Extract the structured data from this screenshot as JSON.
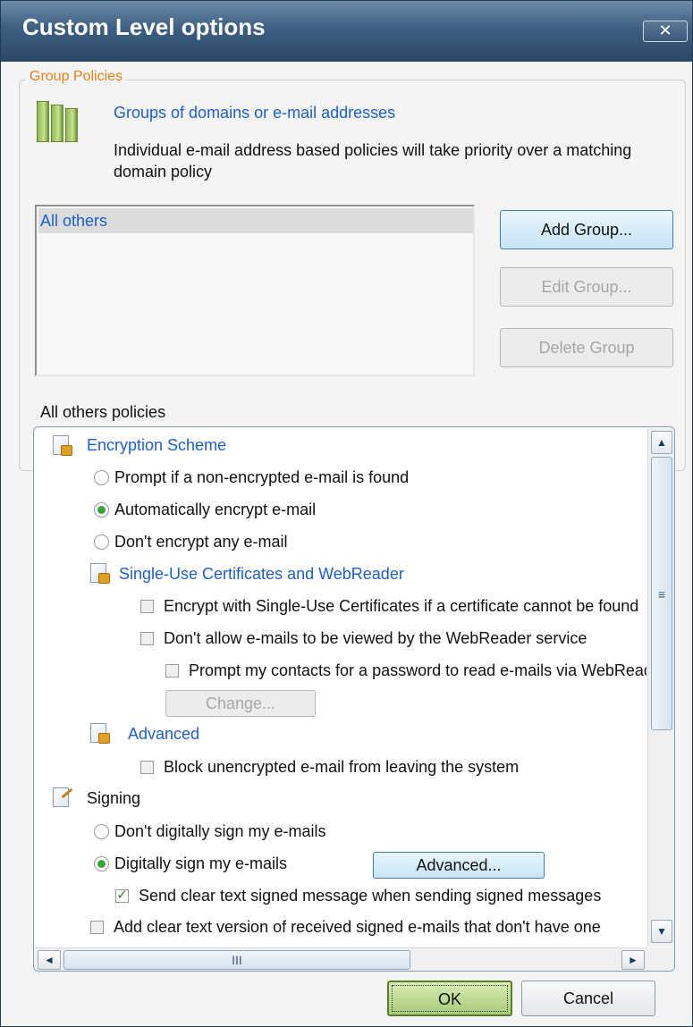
{
  "window": {
    "title": "Custom Level options",
    "close_glyph": "✕"
  },
  "group_policies": {
    "legend": "Group Policies",
    "icon": "server-group-icon",
    "heading": "Groups of domains or e-mail addresses",
    "description": "Individual e-mail address based policies will take priority over a matching domain policy",
    "list_items": [
      "All others"
    ],
    "add_label": "Add Group...",
    "edit_label": "Edit Group...",
    "delete_label": "Delete Group"
  },
  "policies": {
    "label": "All others policies",
    "encryption": {
      "title": "Encryption Scheme",
      "opt_prompt": "Prompt if a non-encrypted e-mail is found",
      "opt_auto": "Automatically encrypt e-mail",
      "opt_none": "Don't encrypt any e-mail",
      "selected": "Automatically encrypt e-mail"
    },
    "single_use": {
      "title": "Single-Use Certificates and WebReader",
      "chk_encrypt": "Encrypt with Single-Use Certificates if a certificate cannot be found",
      "chk_disallow": "Don't allow e-mails to be viewed by the WebReader service",
      "chk_prompt": "Prompt my contacts for a password to read e-mails via WebReader",
      "change_label": "Change..."
    },
    "advanced": {
      "title": "Advanced",
      "chk_block": "Block unencrypted e-mail from leaving the system"
    },
    "signing": {
      "title": "Signing",
      "opt_dont": "Don't digitally sign my e-mails",
      "opt_sign": "Digitally sign my e-mails",
      "advanced_label": "Advanced...",
      "chk_clear": "Send clear text signed message when sending signed messages",
      "chk_add_clear": "Add clear text version of received signed e-mails that don't have one",
      "selected": "Digitally sign my e-mails",
      "clear_checked": true
    }
  },
  "scroll": {
    "up": "▲",
    "down": "▼",
    "left": "◄",
    "right": "►",
    "grip_v": "≡",
    "grip_h": "III"
  },
  "buttons": {
    "ok": "OK",
    "cancel": "Cancel"
  },
  "colors": {
    "title_bar": "#3e5f82",
    "link_blue": "#1c5fc9",
    "legend_orange": "#e8811a",
    "ok_green": "#b5d58a"
  }
}
